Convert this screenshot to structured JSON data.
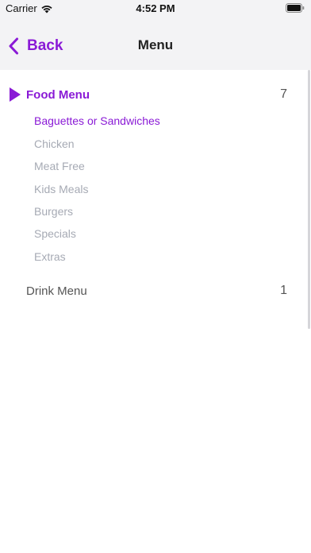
{
  "status_bar": {
    "carrier": "Carrier",
    "time": "4:52 PM",
    "icons": [
      "wifi-icon",
      "battery-icon"
    ]
  },
  "nav": {
    "back_label": "Back",
    "title": "Menu"
  },
  "sections": [
    {
      "label": "Food Menu",
      "count": "7",
      "expanded": true,
      "items": [
        "Baguettes or Sandwiches",
        "Chicken",
        "Meat Free",
        "Kids Meals",
        "Burgers",
        "Specials",
        "Extras"
      ],
      "active_item": "Baguettes or Sandwiches"
    },
    {
      "label": "Drink Menu",
      "count": "1",
      "expanded": false
    }
  ],
  "colors": {
    "accent": "#8a1ad6",
    "inactive_text": "#a6aab4",
    "bar_background": "#f3f3f5"
  }
}
